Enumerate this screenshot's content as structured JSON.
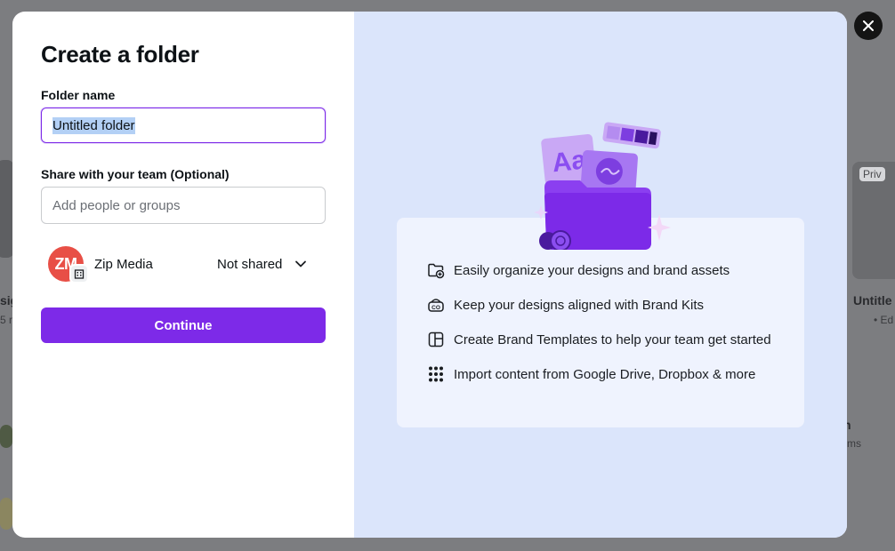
{
  "background": {
    "right_card_badge": "Priv",
    "right_card_title": "Untitle",
    "right_card_sub": "• Ed",
    "left_partial_title": "sig",
    "left_partial_sub": "5 m",
    "right_lower_title": "n",
    "right_lower_sub": "ms"
  },
  "modal": {
    "title": "Create a folder",
    "folder_name_label": "Folder name",
    "folder_name_value": "Untitled folder",
    "share_label": "Share with your team (Optional)",
    "share_placeholder": "Add people or groups",
    "member": {
      "initials": "ZM",
      "name": "Zip Media",
      "permission": "Not shared"
    },
    "continue_label": "Continue"
  },
  "features": [
    {
      "icon": "folder-plus-icon",
      "text": "Easily organize your designs and brand assets"
    },
    {
      "icon": "brand-kit-icon",
      "text": "Keep your designs aligned with Brand Kits"
    },
    {
      "icon": "template-icon",
      "text": "Create Brand Templates to help your team get started"
    },
    {
      "icon": "apps-grid-icon",
      "text": "Import content from Google Drive, Dropbox & more"
    }
  ],
  "colors": {
    "accent": "#7d2ae8",
    "panel": "#dbe5fb",
    "avatar": "#e84f46"
  }
}
